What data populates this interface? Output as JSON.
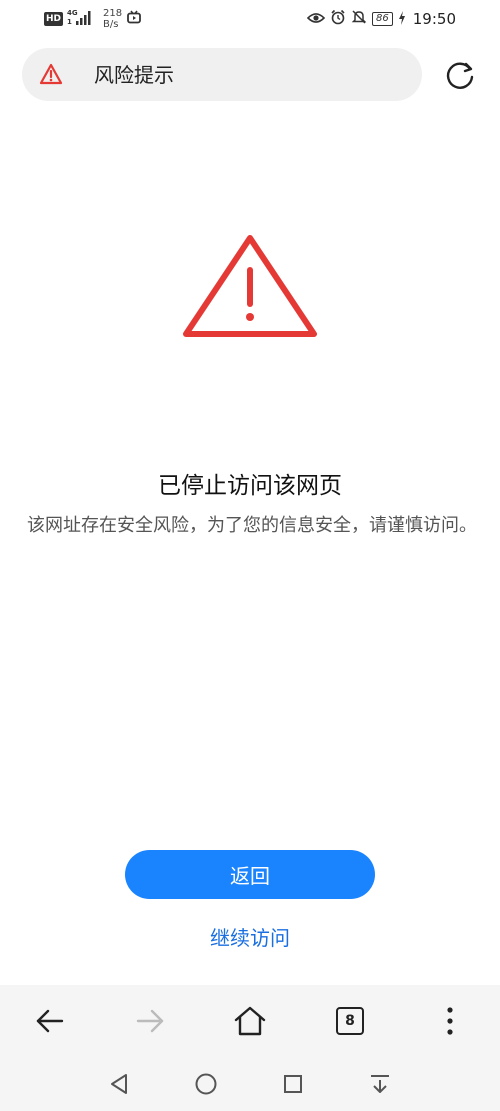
{
  "status_bar": {
    "hd_label": "HD",
    "network_top": "4G",
    "network_bottom": "⁴⁶",
    "speed_value": "218",
    "speed_unit": "B/s",
    "battery": "86",
    "time": "19:50",
    "icons": [
      "hd-icon",
      "signal-icon",
      "tv-icon",
      "eye-icon",
      "alarm-icon",
      "mute-icon",
      "battery-icon",
      "charging-icon"
    ]
  },
  "address_bar": {
    "title": "风险提示",
    "icon": "warning-icon"
  },
  "page": {
    "heading": "已停止访问该网页",
    "description": "该网址存在安全风险，为了您的信息安全，请谨慎访问。"
  },
  "actions": {
    "back_label": "返回",
    "continue_label": "继续访问"
  },
  "toolbar": {
    "tab_count": "8",
    "icons": [
      "back-arrow-icon",
      "forward-arrow-icon",
      "home-icon",
      "tabs-icon",
      "more-icon"
    ]
  },
  "navigation": {
    "icons": [
      "nav-back-icon",
      "nav-home-icon",
      "nav-recents-icon",
      "nav-notification-icon"
    ]
  },
  "colors": {
    "accent": "#1a84ff",
    "link": "#1a6fe0",
    "warning": "#e53935"
  }
}
